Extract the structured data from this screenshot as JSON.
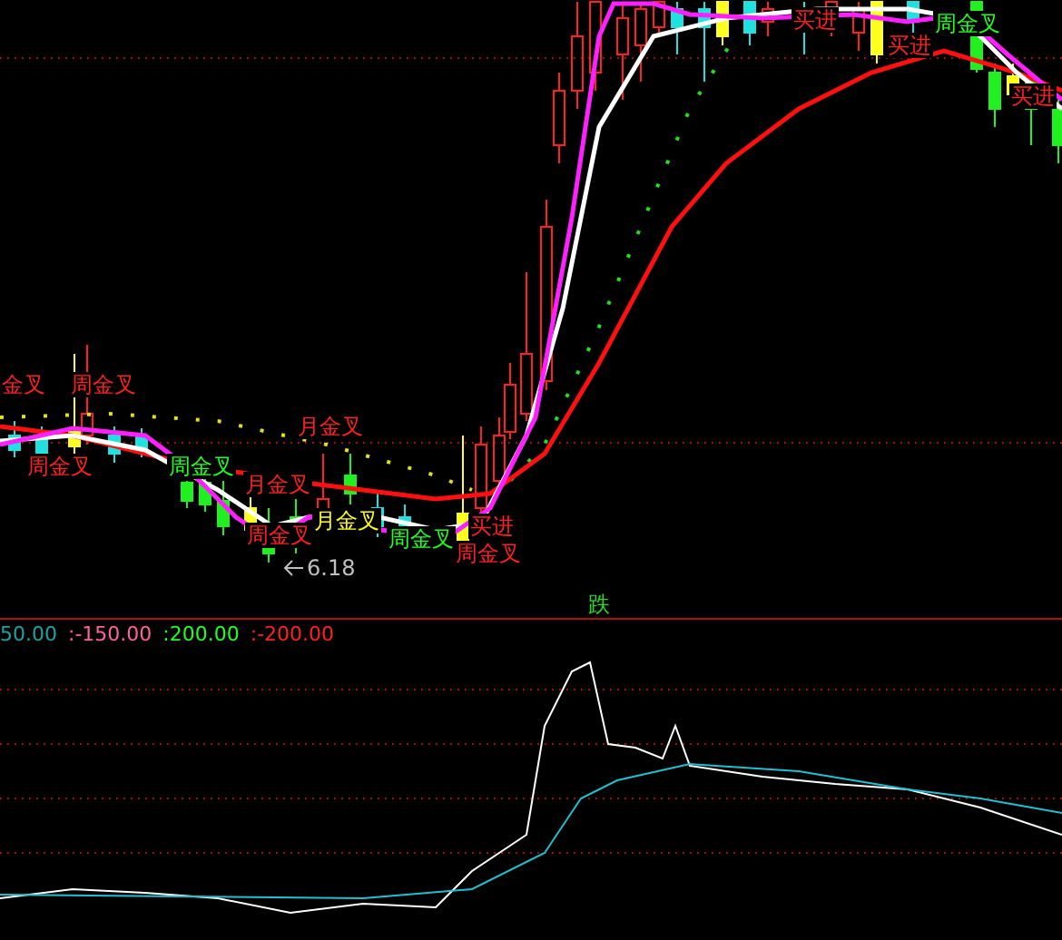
{
  "main_chart": {
    "signals": [
      {
        "text": "金叉",
        "color": "#ff2020"
      },
      {
        "text": "周金叉",
        "color": "#ff2020"
      },
      {
        "text": "周金叉",
        "color": "#ff2020"
      },
      {
        "text": "月金叉",
        "color": "#ff2020"
      },
      {
        "text": "周金叉",
        "color": "#20ff20"
      },
      {
        "text": "月金叉",
        "color": "#ff2020"
      },
      {
        "text": "周金叉",
        "color": "#ff2020"
      },
      {
        "text": "月金叉",
        "color": "#ffff20"
      },
      {
        "text": "周金叉",
        "color": "#20ff20"
      },
      {
        "text": "买进",
        "color": "#ff2020"
      },
      {
        "text": "周金叉",
        "color": "#ff2020"
      },
      {
        "text": "买进",
        "color": "#ff2020"
      },
      {
        "text": "买进",
        "color": "#ff2020"
      },
      {
        "text": "周金叉",
        "color": "#20ff20"
      },
      {
        "text": "买进",
        "color": "#ff2020"
      }
    ],
    "low_marker": "6.18",
    "fall_marker": "跌"
  },
  "indicator": {
    "values": [
      {
        "text": "50.00",
        "color": "#20a0a0"
      },
      {
        "text": ":-150.00",
        "color": "#ff60a0"
      },
      {
        "text": ":200.00",
        "color": "#20ff20"
      },
      {
        "text": ":-200.00",
        "color": "#ff2020"
      }
    ]
  }
}
